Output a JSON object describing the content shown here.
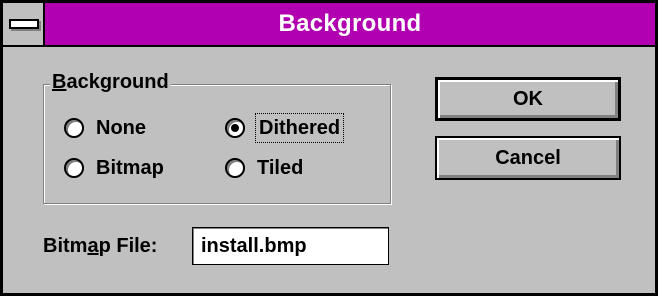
{
  "window": {
    "title": "Background",
    "title_bar_color": "#b000b0",
    "system_menu_icon": "system-menu-icon"
  },
  "group": {
    "label_accel": "B",
    "label_rest": "ackground"
  },
  "radios": [
    {
      "label": "None",
      "checked": false
    },
    {
      "label": "Dithered",
      "checked": true
    },
    {
      "label": "Bitmap",
      "checked": false
    },
    {
      "label": "Tiled",
      "checked": false
    }
  ],
  "buttons": {
    "ok_label": "OK",
    "cancel_label": "Cancel"
  },
  "bitmap_file": {
    "label_pre": "Bitm",
    "label_accel": "a",
    "label_post": "p File:",
    "value": "install.bmp"
  }
}
